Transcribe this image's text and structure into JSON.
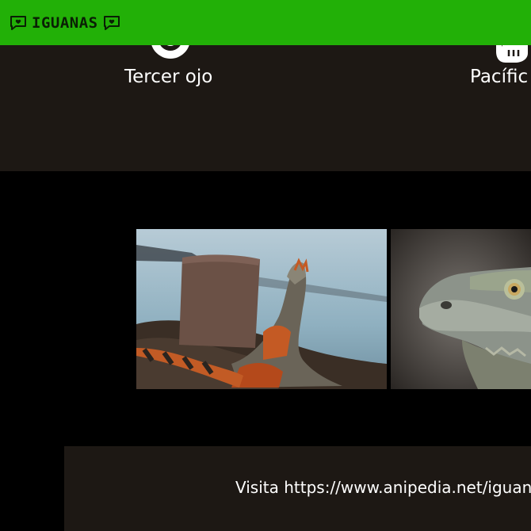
{
  "header": {
    "brand": "IGUANAS",
    "icons": [
      "chat-heart-icon",
      "chat-heart-icon"
    ],
    "background": "#22b007"
  },
  "features": [
    {
      "label": "Tercer ojo",
      "icon": "eye-icon"
    },
    {
      "label": "Pacífic",
      "icon": "hand-icon"
    }
  ],
  "gallery": {
    "photos": [
      {
        "description_icon": "iguana-on-rocks-photo"
      },
      {
        "description_icon": "iguana-head-closeup-photo"
      }
    ]
  },
  "footer": {
    "text": "Visita https://www.anipedia.net/iguanas"
  },
  "colors": {
    "header_green": "#22b007",
    "panel_dark": "#1d1814",
    "background": "#000000"
  }
}
